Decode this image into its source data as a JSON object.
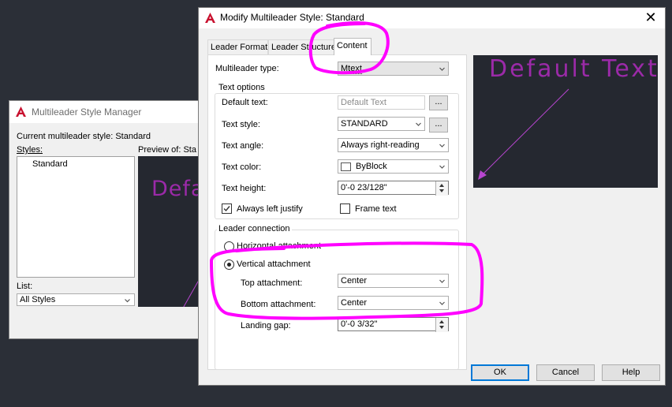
{
  "manager": {
    "title": "Multileader Style Manager",
    "current_style_label": "Current multileader style: Standard",
    "styles_label": "Styles:",
    "styles": [
      "Standard"
    ],
    "preview_label": "Preview of: Sta",
    "preview_text": "Default Text",
    "list_label": "List:",
    "list_value": "All Styles"
  },
  "dialog": {
    "title": "Modify Multileader Style: Standard",
    "tabs": [
      {
        "label": "Leader Format"
      },
      {
        "label": "Leader Structure"
      },
      {
        "label": "Content"
      }
    ],
    "multileader_type_label": "Multileader type:",
    "multileader_type_value": "Mtext",
    "text_options_title": "Text options",
    "default_text_label": "Default text:",
    "default_text_value": "Default Text",
    "browse_label": "...",
    "text_style_label": "Text style:",
    "text_style_value": "STANDARD",
    "text_angle_label": "Text angle:",
    "text_angle_value": "Always right-reading",
    "text_color_label": "Text color:",
    "text_color_value": "ByBlock",
    "text_height_label": "Text height:",
    "text_height_value": "0'-0 23/128\"",
    "always_left_justify_label": "Always left justify",
    "always_left_justify_checked": true,
    "frame_text_label": "Frame text",
    "frame_text_checked": false,
    "leader_connection_title": "Leader connection",
    "horizontal_attachment_label": "Horizontal attachment",
    "vertical_attachment_label": "Vertical attachment",
    "top_attachment_label": "Top attachment:",
    "top_attachment_value": "Center",
    "bottom_attachment_label": "Bottom attachment:",
    "bottom_attachment_value": "Center",
    "landing_gap_label": "Landing gap:",
    "landing_gap_value": "0'-0 3/32\"",
    "preview_text": "Default Text",
    "ok_label": "OK",
    "cancel_label": "Cancel",
    "help_label": "Help"
  },
  "colors": {
    "desktop": "#2b2f37",
    "preview_bg": "#252830",
    "preview_text": "#9b2aa8",
    "leader_line": "#b845d0",
    "annotation": "#ff00ff",
    "autocad_red": "#c8102e"
  },
  "icons": {
    "app": "autocad-a-icon",
    "close": "close-icon",
    "dropdown": "chevron-down-icon",
    "spinner": "spinner-arrows-icon"
  }
}
